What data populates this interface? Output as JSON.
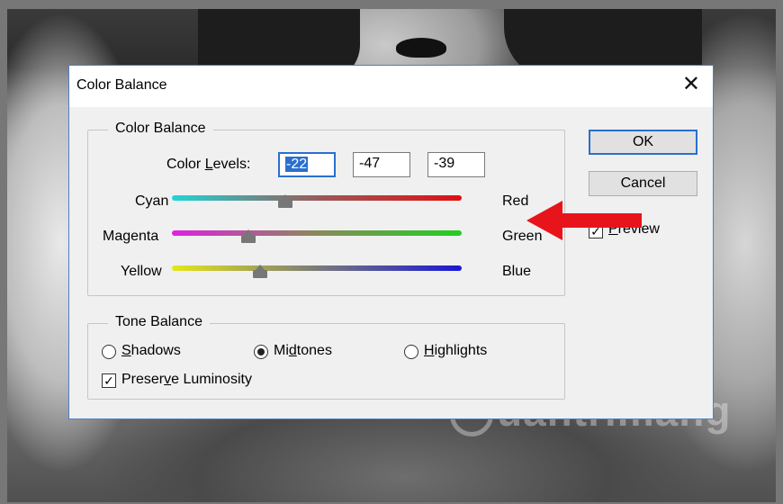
{
  "dialog": {
    "title": "Color Balance",
    "close_glyph": "✕"
  },
  "color_balance": {
    "group_label": "Color Balance",
    "levels_label_prefix": "Color ",
    "levels_label_ul": "L",
    "levels_label_suffix": "evels:",
    "levels": [
      "-22",
      "-47",
      "-39"
    ],
    "sliders": [
      {
        "left": "Cyan",
        "right": "Red",
        "value": -22
      },
      {
        "left": "Magenta",
        "right": "Green",
        "value": -47
      },
      {
        "left": "Yellow",
        "right": "Blue",
        "value": -39
      }
    ]
  },
  "tone_balance": {
    "group_label": "Tone Balance",
    "shadows_ul": "S",
    "shadows_rest": "hadows",
    "midtones_pre": "Mi",
    "midtones_ul": "d",
    "midtones_rest": "tones",
    "highlights_ul": "H",
    "highlights_rest": "ighlights",
    "selected": "Midtones",
    "preserve_pre": "Preser",
    "preserve_ul": "v",
    "preserve_rest": "e Luminosity",
    "preserve_checked": true
  },
  "buttons": {
    "ok": "OK",
    "cancel": "Cancel",
    "preview_ul": "P",
    "preview_rest": "review",
    "preview_checked": true
  },
  "overlay": {
    "arrow_color": "#e8141b",
    "watermark": "uantrimang",
    "watermark_icon": "bulb-logo-icon"
  },
  "colors": {
    "accent": "#2a6fcf",
    "dialog_bg": "#f0f0f0"
  }
}
